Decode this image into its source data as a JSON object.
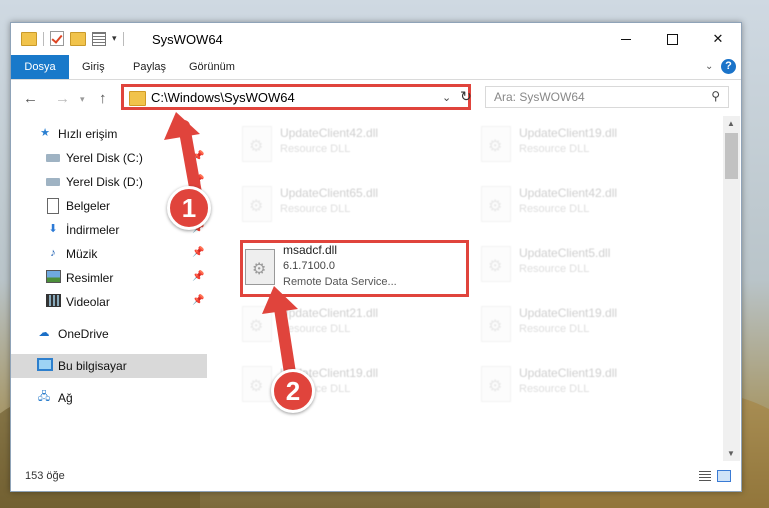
{
  "window": {
    "title": "SysWOW64"
  },
  "ribbon": {
    "tabs": [
      "Dosya",
      "Giriş",
      "Paylaş",
      "Görünüm"
    ],
    "help_label": "?"
  },
  "address_bar": {
    "path": "C:\\Windows\\SysWOW64",
    "search_placeholder": "Ara: SysWOW64"
  },
  "sidebar": {
    "quick_access_label": "Hızlı erişim",
    "items": [
      {
        "label": "Yerel Disk (C:)",
        "icon": "disk-icon",
        "pinned": true
      },
      {
        "label": "Yerel Disk (D:)",
        "icon": "disk-icon",
        "pinned": true
      },
      {
        "label": "Belgeler",
        "icon": "document-icon",
        "pinned": true
      },
      {
        "label": "İndirmeler",
        "icon": "download-icon",
        "pinned": true
      },
      {
        "label": "Müzik",
        "icon": "music-icon",
        "pinned": true
      },
      {
        "label": "Resimler",
        "icon": "pictures-icon",
        "pinned": true
      },
      {
        "label": "Videolar",
        "icon": "videos-icon",
        "pinned": true
      }
    ],
    "onedrive_label": "OneDrive",
    "this_pc_label": "Bu bilgisayar",
    "network_label": "Ağ"
  },
  "files": {
    "items": [
      {
        "name": "UpdateClient42.dll",
        "desc": "Resource DLL",
        "faded": true
      },
      {
        "name": "UpdateClient19.dll",
        "desc": "Resource DLL",
        "faded": true
      },
      {
        "name": "UpdateClient65.dll",
        "desc": "Resource DLL",
        "faded": true
      },
      {
        "name": "UpdateClient42.dll",
        "desc": "Resource DLL",
        "faded": true
      },
      {
        "name": "msadcf.dll",
        "version": "6.1.7100.0",
        "desc": "Remote Data Service...",
        "faded": false
      },
      {
        "name": "UpdateClient5.dll",
        "desc": "Resource DLL",
        "faded": true
      },
      {
        "name": "UpdateClient21.dll",
        "desc": "Resource DLL",
        "faded": true
      },
      {
        "name": "UpdateClient19.dll",
        "desc": "Resource DLL",
        "faded": true
      },
      {
        "name": "UpdateClient19.dll",
        "desc": "Resource DLL",
        "faded": true
      },
      {
        "name": "UpdateClient19.dll",
        "desc": "Resource DLL",
        "faded": true
      }
    ]
  },
  "status": {
    "item_count": "153 öğe"
  },
  "annotations": {
    "badge1": "1",
    "badge2": "2",
    "color": "#e0443c"
  }
}
